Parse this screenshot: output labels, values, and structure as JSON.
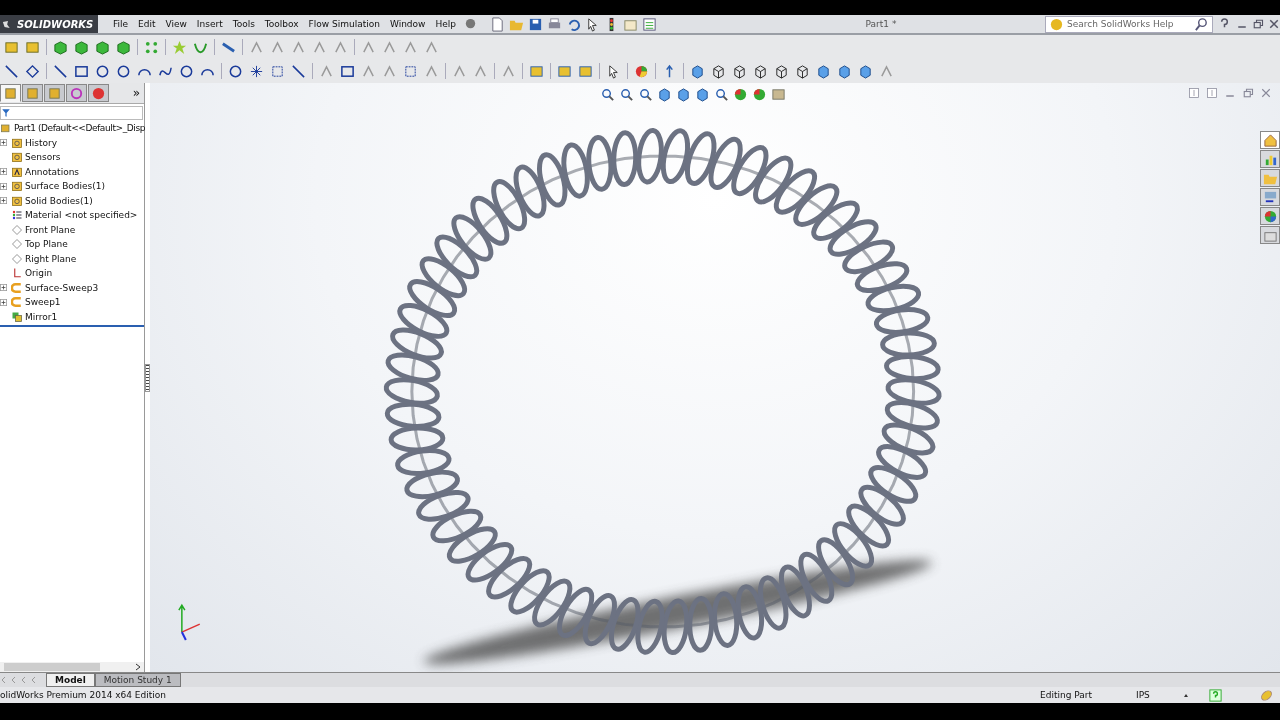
{
  "app": {
    "logo": "SOLIDWORKS",
    "menu": [
      "File",
      "Edit",
      "View",
      "Insert",
      "Tools",
      "Toolbox",
      "Flow Simulation",
      "Window",
      "Help"
    ],
    "title": "Part1 *"
  },
  "search": {
    "placeholder": "Search SolidWorks Help"
  },
  "panel": {
    "more": "»",
    "tabs": [
      {
        "selected": true
      },
      {
        "selected": false
      },
      {
        "selected": false
      },
      {
        "selected": false
      },
      {
        "selected": false
      }
    ]
  },
  "tree": {
    "root": "Part1  (Default<<Default>_Disp",
    "items": [
      {
        "label": "History",
        "kind": "folder",
        "expandable": true
      },
      {
        "label": "Sensors",
        "kind": "folder",
        "expandable": false
      },
      {
        "label": "Annotations",
        "kind": "annotation",
        "expandable": true
      },
      {
        "label": "Surface Bodies(1)",
        "kind": "folder",
        "expandable": true
      },
      {
        "label": "Solid Bodies(1)",
        "kind": "folder",
        "expandable": true
      },
      {
        "label": "Material <not specified>",
        "kind": "material",
        "expandable": false
      },
      {
        "label": "Front Plane",
        "kind": "plane",
        "expandable": false
      },
      {
        "label": "Top Plane",
        "kind": "plane",
        "expandable": false
      },
      {
        "label": "Right Plane",
        "kind": "plane",
        "expandable": false
      },
      {
        "label": "Origin",
        "kind": "origin",
        "expandable": false
      },
      {
        "label": "Surface-Sweep3",
        "kind": "sweep",
        "expandable": true
      },
      {
        "label": "Sweep1",
        "kind": "sweep",
        "expandable": true
      },
      {
        "label": "Mirror1",
        "kind": "mirror",
        "expandable": false
      }
    ]
  },
  "task_pane": {
    "tabs": [
      {
        "selected": true
      },
      {
        "selected": false
      },
      {
        "selected": false
      },
      {
        "selected": false
      },
      {
        "selected": false
      },
      {
        "selected": false
      }
    ]
  },
  "bottom_tabs": [
    {
      "label": "Model",
      "selected": true
    },
    {
      "label": "Motion Study 1",
      "selected": false
    }
  ],
  "status_bar": {
    "edition": "olidWorks Premium 2014 x64 Edition",
    "mode": "Editing Part",
    "units": "IPS"
  }
}
